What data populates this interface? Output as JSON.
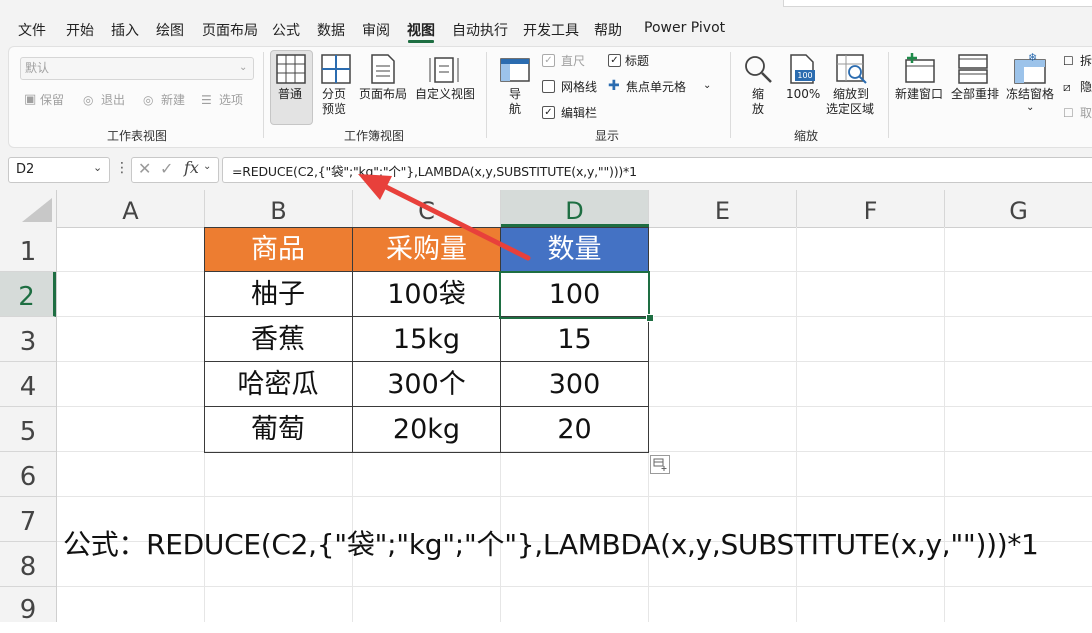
{
  "menu": {
    "tabs": [
      "文件",
      "开始",
      "插入",
      "绘图",
      "页面布局",
      "公式",
      "数据",
      "审阅",
      "视图",
      "自动执行",
      "开发工具",
      "帮助",
      "Power Pivot"
    ],
    "active_tab": "视图"
  },
  "ribbon": {
    "sheet_view": {
      "dropdown_value": "默认",
      "keep": "保留",
      "exit": "退出",
      "new": "新建",
      "options": "选项",
      "group_label": "工作表视图"
    },
    "workbook_views": {
      "normal": "普通",
      "page_break_line1": "分页",
      "page_break_line2": "预览",
      "page_layout": "页面布局",
      "custom_views": "自定义视图",
      "group_label": "工作簿视图"
    },
    "navigation": {
      "label_line1": "导",
      "label_line2": "航"
    },
    "show": {
      "ruler": "直尺",
      "gridlines": "网格线",
      "formula_bar": "编辑栏",
      "headings": "标题",
      "focus_cell": "焦点单元格",
      "group_label": "显示",
      "ruler_checked": true,
      "gridlines_checked": false,
      "formula_bar_checked": true,
      "headings_checked": true
    },
    "zoom": {
      "zoom_line1": "缩",
      "zoom_line2": "放",
      "zoom_100": "100%",
      "zoom_100_badge": "100",
      "zoom_sel_line1": "缩放到",
      "zoom_sel_line2": "选定区域",
      "group_label": "缩放"
    },
    "window": {
      "new_window": "新建窗口",
      "arrange_all": "全部重排",
      "freeze_panes": "冻结窗格",
      "split_partial": "拆",
      "hide_partial": "隐",
      "unhide_partial": "取"
    }
  },
  "formula_bar": {
    "name_box": "D2",
    "fx": "fx",
    "formula": "=REDUCE(C2,{\"袋\";\"kg\";\"个\"},LAMBDA(x,y,SUBSTITUTE(x,y,\"\")))*1"
  },
  "sheet": {
    "columns": [
      "A",
      "B",
      "C",
      "D",
      "E",
      "F",
      "G"
    ],
    "selected_column": "D",
    "rows": [
      "1",
      "2",
      "3",
      "4",
      "5",
      "6",
      "7",
      "8",
      "9"
    ],
    "selected_row": "2",
    "table": {
      "headers": [
        "商品",
        "采购量",
        "数量"
      ],
      "rows": [
        [
          "柚子",
          "100袋",
          "100"
        ],
        [
          "香蕉",
          "15kg",
          "15"
        ],
        [
          "哈密瓜",
          "300个",
          "300"
        ],
        [
          "葡萄",
          "20kg",
          "20"
        ]
      ]
    },
    "formula_note": "公式：REDUCE(C2,{\"袋\";\"kg\";\"个\"},LAMBDA(x,y,SUBSTITUTE(x,y,\"\")))*1"
  },
  "colors": {
    "header_orange": "#ed7d31",
    "header_blue": "#4472c4",
    "selection_green": "#1e6e42",
    "annotation_arrow": "#e8403b"
  }
}
